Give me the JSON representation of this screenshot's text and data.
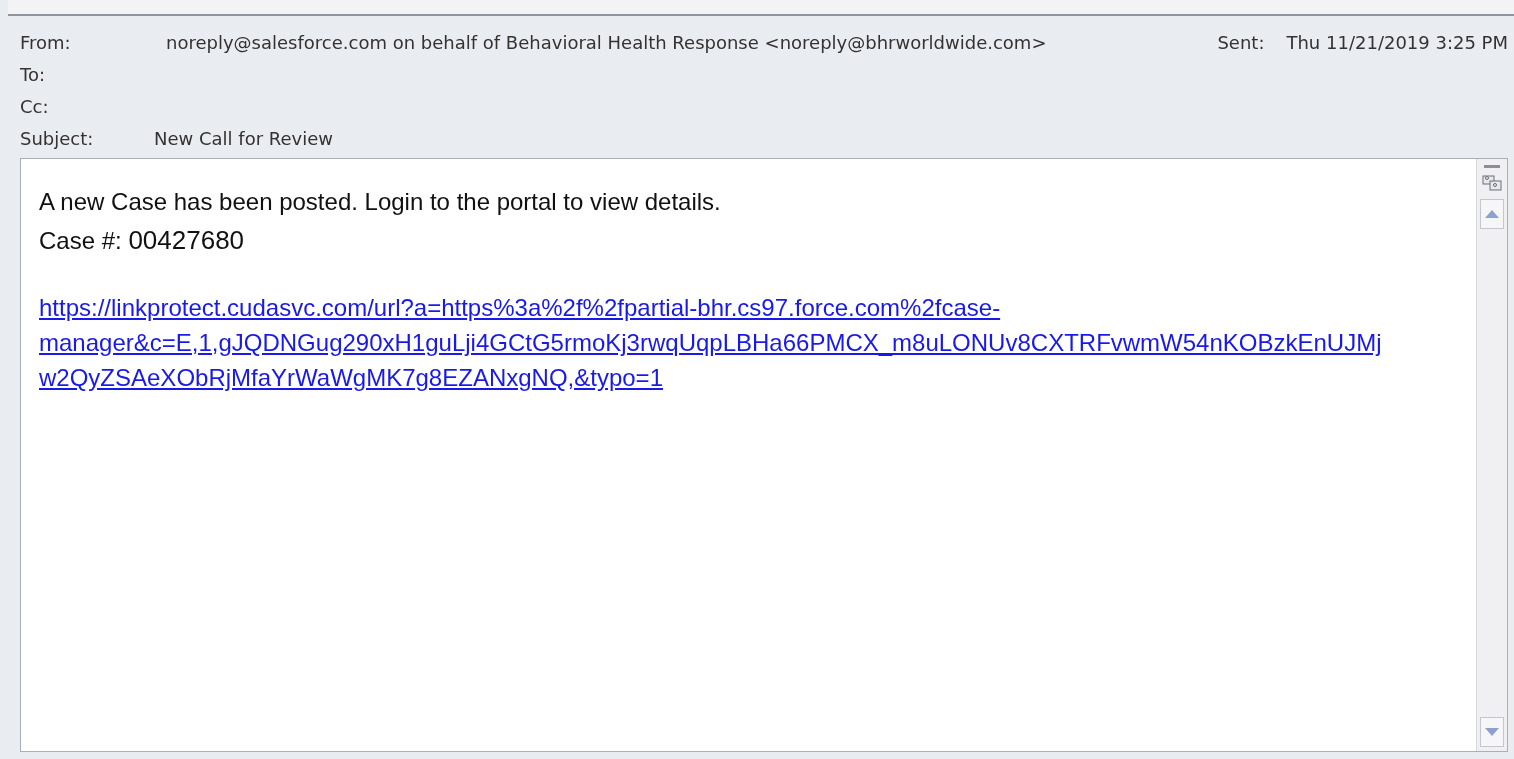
{
  "header": {
    "fields": [
      {
        "label": "From:",
        "value": "noreply@salesforce.com on behalf of Behavioral Health Response <noreply@bhrworldwide.com>"
      },
      {
        "label": "To:"
      },
      {
        "label": "Cc:"
      },
      {
        "label": "Subject:",
        "value": "New Call for Review"
      }
    ],
    "sent": {
      "label": "Sent:",
      "value": "Thu 11/21/2019 3:25 PM"
    }
  },
  "body": {
    "intro": "A new Case has been posted. Login to the portal to view details.",
    "case_label": "Case #:",
    "case_number": "00427680",
    "link_lines": [
      "https://linkprotect.cudasvc.com/url?a=https%3a%2f%2fpartial-bhr.cs97.force.com%2fcase-",
      "manager&c=E,1,gJQDNGug290xH1guLji4GCtG5rmoKj3rwqUqpLBHa66PMCX_m8uLONUv8CXTRFvwmW54nKOBzkEnUJMj",
      "w2QyZSAeXObRjMfaYrWaWgMK7g8EZANxgNQ,&typo=1"
    ]
  }
}
